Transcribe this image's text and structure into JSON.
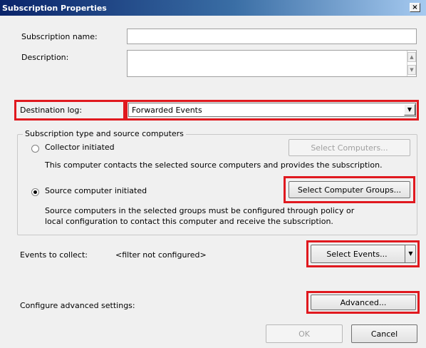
{
  "window": {
    "title": "Subscription Properties",
    "close_label": "×"
  },
  "fields": {
    "subscription_name_label": "Subscription name:",
    "subscription_name_value": "",
    "description_label": "Description:",
    "description_value": "",
    "destination_log_label": "Destination log:",
    "destination_log_value": "Forwarded Events"
  },
  "subscription_type": {
    "legend": "Subscription type and source computers",
    "collector_label": "Collector initiated",
    "collector_button": "Select Computers...",
    "collector_desc": "This computer contacts the selected source computers and provides the subscription.",
    "source_label": "Source computer initiated",
    "source_button": "Select Computer Groups...",
    "source_desc_line1": "Source computers in the selected groups must be configured through policy or",
    "source_desc_line2": "local configuration to contact this computer and receive the subscription.",
    "selected": "source"
  },
  "events": {
    "label": "Events to collect:",
    "value": "<filter not configured>",
    "button": "Select Events..."
  },
  "advanced": {
    "label": "Configure advanced settings:",
    "button": "Advanced..."
  },
  "footer": {
    "ok": "OK",
    "cancel": "Cancel"
  },
  "colors": {
    "highlight": "#e0191f",
    "title_bar": "#0a246a"
  }
}
